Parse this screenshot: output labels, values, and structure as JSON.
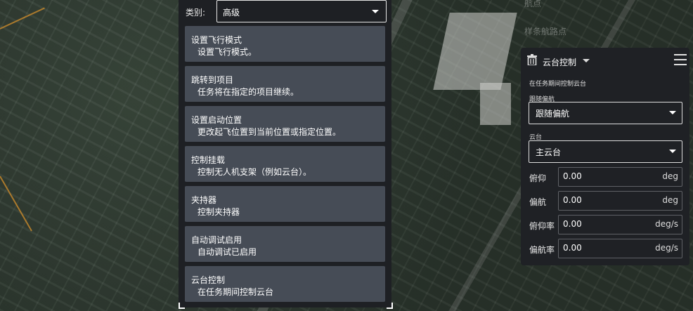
{
  "map": {
    "top_label": "航点",
    "spline_label": "样条航路点"
  },
  "category": {
    "label": "类别:",
    "value": "高级"
  },
  "commands": [
    {
      "title": "设置飞行模式",
      "desc": "设置飞行模式。"
    },
    {
      "title": "跳转到项目",
      "desc": "任务将在指定的项目继续。"
    },
    {
      "title": "设置启动位置",
      "desc": "更改起飞位置到当前位置或指定位置。"
    },
    {
      "title": "控制挂载",
      "desc": "控制无人机支架（例如云台）。"
    },
    {
      "title": "夹持器",
      "desc": "控制夹持器"
    },
    {
      "title": "自动调试启用",
      "desc": "自动调试已启用"
    },
    {
      "title": "云台控制",
      "desc": "在任务期间控制云台"
    }
  ],
  "editor": {
    "title": "云台控制",
    "description": "在任务期间控制云台",
    "yaw_follow_label": "跟随偏航",
    "yaw_follow_value": "跟随偏航",
    "gimbal_label": "云台",
    "gimbal_value": "主云台",
    "fields": [
      {
        "label": "俯仰",
        "value": "0.00",
        "unit": "deg"
      },
      {
        "label": "偏航",
        "value": "0.00",
        "unit": "deg"
      },
      {
        "label": "俯仰率",
        "value": "0.00",
        "unit": "deg/s"
      },
      {
        "label": "偏航率",
        "value": "0.00",
        "unit": "deg/s"
      }
    ]
  }
}
